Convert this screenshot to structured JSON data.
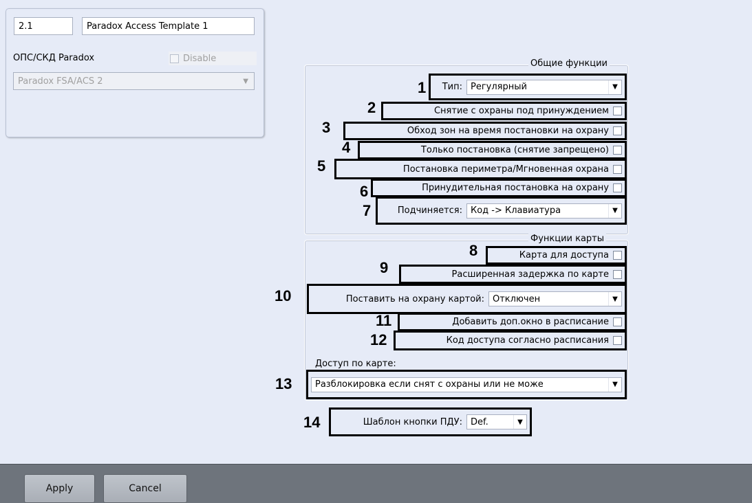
{
  "object": {
    "id": "2.1",
    "name": "Paradox Access Template 1",
    "parent_label": "ОПС/СКД Paradox",
    "disable_label": "Disable",
    "device": "Paradox FSA/ACS 2"
  },
  "general": {
    "title": "Общие функции",
    "type_label": "Тип:",
    "type_value": "Регулярный",
    "duress_label": "Снятие с охраны под принуждением",
    "bypass_label": "Обход зон на время постановки на охрану",
    "arm_only_label": "Только постановка (снятие запрещено)",
    "perimeter_label": "Постановка периметра/Мгновенная охрана",
    "force_arm_label": "Принудительная постановка на охрану",
    "subordinate_label": "Подчиняется:",
    "subordinate_value": "Код -> Клавиатура"
  },
  "card": {
    "title": "Функции карты",
    "access_label": "Карта для доступа",
    "extended_delay_label": "Расширенная задержка по карте",
    "arm_by_card_label": "Поставить на охрану картой:",
    "arm_by_card_value": "Отключен",
    "add_window_label": "Добавить доп.окно в расписание",
    "code_schedule_label": "Код доступа согласно расписания",
    "card_access_label": "Доступ по карте:",
    "card_access_value": "Разблокировка если снят с охраны или не може"
  },
  "remote": {
    "label": "Шаблон кнопки ПДУ:",
    "value": "Def."
  },
  "markers": [
    "1",
    "2",
    "3",
    "4",
    "5",
    "6",
    "7",
    "8",
    "9",
    "10",
    "11",
    "12",
    "13",
    "14"
  ],
  "buttons": {
    "apply": "Apply",
    "cancel": "Cancel"
  },
  "colors": {
    "background": "#e6ebf7",
    "bottom_bar": "#6e747c",
    "highlight_border": "#000000"
  }
}
